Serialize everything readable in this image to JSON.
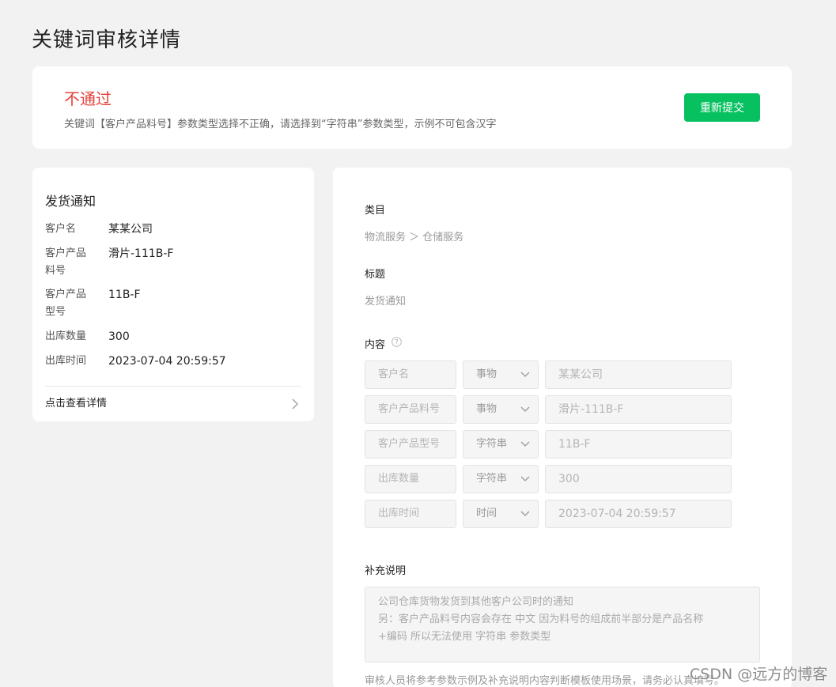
{
  "page": {
    "title": "关键词审核详情"
  },
  "status": {
    "title": "不通过",
    "message": "关键词【客户产品料号】参数类型选择不正确，请选择到“字符串”参数类型，示例不可包含汉字",
    "resubmit_label": "重新提交",
    "colors": {
      "fail": "#e5403a",
      "primary": "#07c160"
    }
  },
  "notice": {
    "title": "发货通知",
    "rows": [
      {
        "key": "客户名",
        "value": "某某公司"
      },
      {
        "key": "客户产品料号",
        "value": "滑片-111B-F"
      },
      {
        "key": "客户产品型号",
        "value": "11B-F"
      },
      {
        "key": "出库数量",
        "value": "300"
      },
      {
        "key": "出库时间",
        "value": "2023-07-04 20:59:57"
      }
    ],
    "detail_link": "点击查看详情"
  },
  "detail": {
    "category_label": "类目",
    "category_value": "物流服务 ＞ 仓储服务",
    "title_label": "标题",
    "title_value": "发货通知",
    "content_label": "内容",
    "params": [
      {
        "name": "客户名",
        "type": "事物",
        "value": "某某公司"
      },
      {
        "name": "客户产品料号",
        "type": "事物",
        "value": "滑片-111B-F"
      },
      {
        "name": "客户产品型号",
        "type": "字符串",
        "value": "11B-F"
      },
      {
        "name": "出库数量",
        "type": "字符串",
        "value": "300"
      },
      {
        "name": "出库时间",
        "type": "时间",
        "value": "2023-07-04 20:59:57"
      }
    ],
    "supplement_label": "补充说明",
    "supplement_lines": [
      "公司仓库货物发货到其他客户公司时的通知",
      "另：客户产品料号内容会存在 中文 因为料号的组成前半部分是产品名称",
      "+编码 所以无法使用 字符串 参数类型"
    ],
    "footer_note": "审核人员将参考参数示例及补充说明内容判断模板使用场景，请务必认真填写。"
  },
  "watermark": "CSDN @远方的博客"
}
